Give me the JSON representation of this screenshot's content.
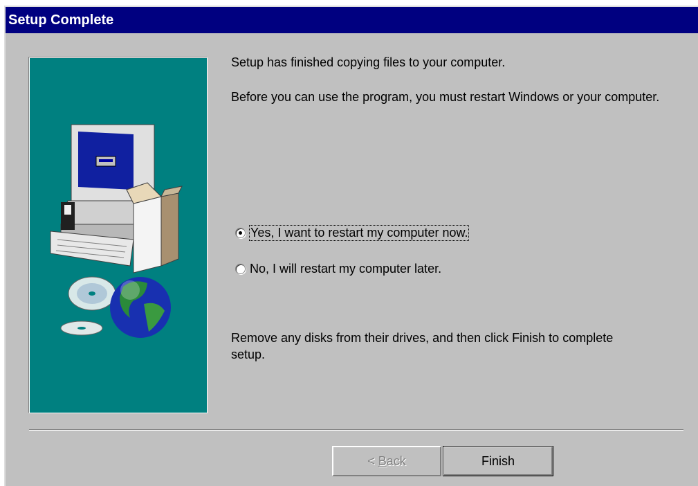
{
  "window": {
    "title": "Setup Complete"
  },
  "content": {
    "line1": "Setup has finished copying files to your computer.",
    "line2": "Before you can use the program, you must restart Windows or your computer.",
    "remove_note": "Remove any disks from their drives, and then click Finish to complete setup."
  },
  "options": {
    "restart_now": {
      "label": "Yes, I want to restart my computer now.",
      "checked": true
    },
    "restart_later": {
      "label": "No, I will restart my computer later.",
      "checked": false
    }
  },
  "buttons": {
    "back_prefix": "< ",
    "back_mnemonic": "B",
    "back_rest": "ack",
    "finish": "Finish"
  },
  "colors": {
    "titlebar": "#000080",
    "dialog": "#c0c0c0",
    "panel": "#008080"
  },
  "illustration": {
    "icons": [
      "computer-icon",
      "software-box-icon",
      "cd-icon",
      "globe-icon"
    ]
  }
}
